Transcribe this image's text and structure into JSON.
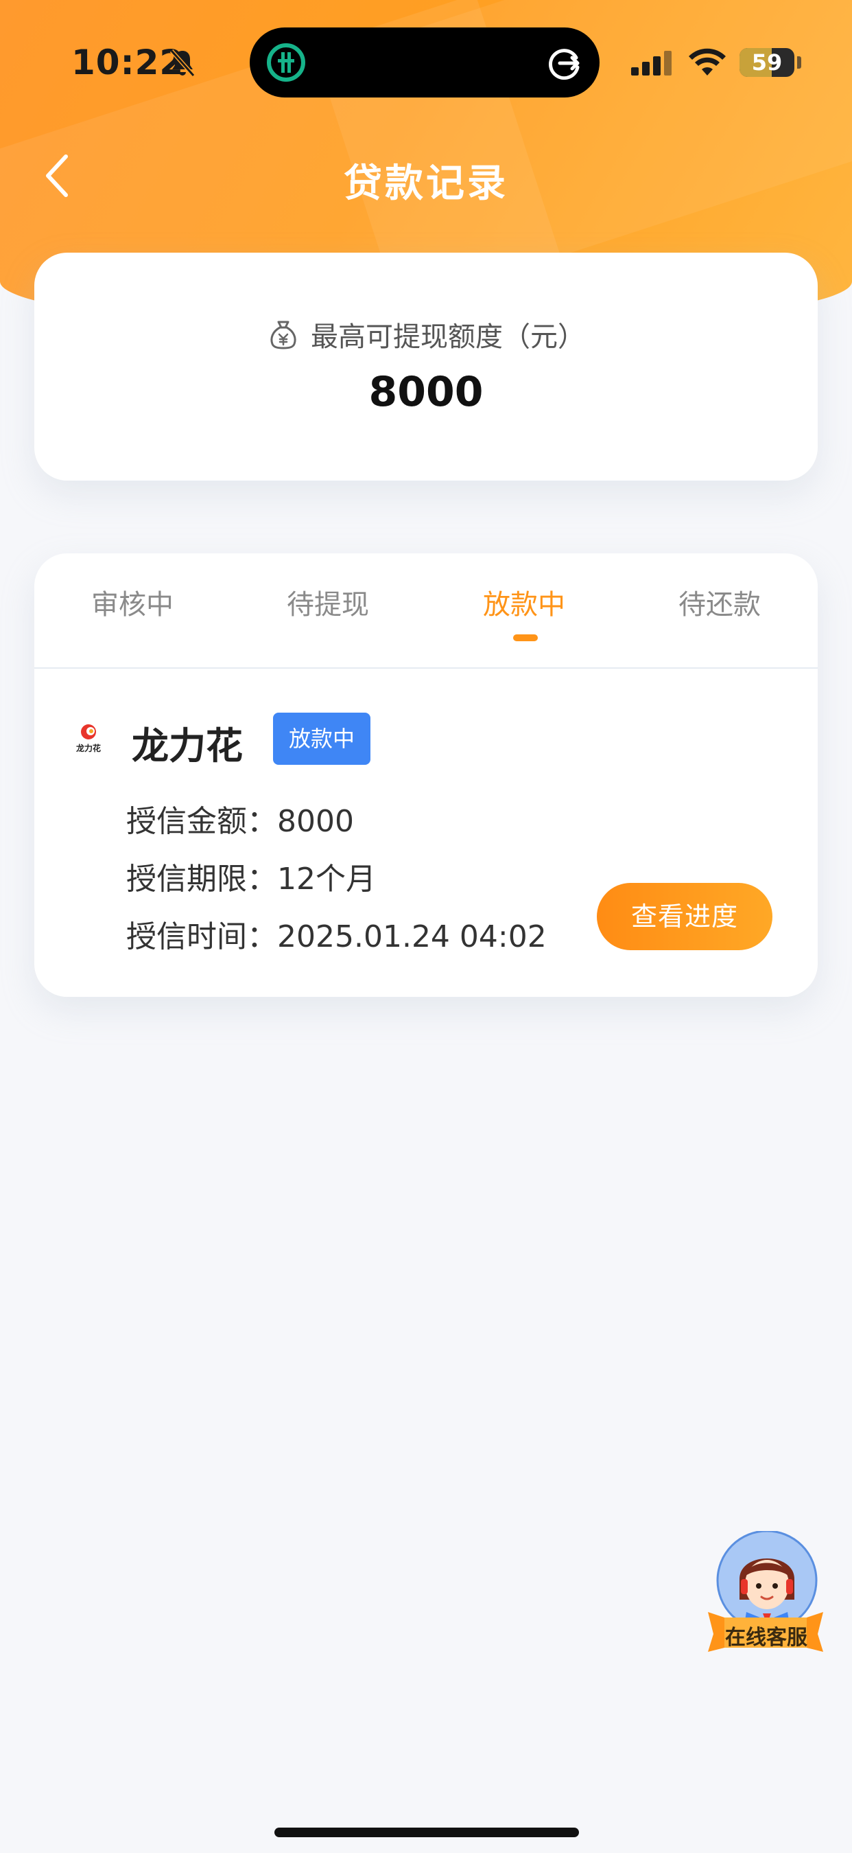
{
  "status_bar": {
    "time": "10:22",
    "battery": "59",
    "battery_level": 0.59,
    "icons": [
      "bell-slash-icon",
      "app-logo-icon",
      "rotate-icon",
      "signal-icon",
      "wifi-icon",
      "battery-icon"
    ]
  },
  "nav": {
    "title": "贷款记录",
    "back_icon": "chevron-left-icon"
  },
  "quota": {
    "icon": "money-bag-icon",
    "label": "最高可提现额度（元）",
    "value": "8000"
  },
  "tabs": [
    {
      "label": "审核中",
      "active": false
    },
    {
      "label": "待提现",
      "active": false
    },
    {
      "label": "放款中",
      "active": true
    },
    {
      "label": "待还款",
      "active": false
    }
  ],
  "loan_item": {
    "brand_logo_text": "龙力花",
    "brand_name": "龙力花",
    "status": "放款中",
    "fields": [
      {
        "key": "授信金额：",
        "value": "8000"
      },
      {
        "key": "授信期限：",
        "value": "12个月"
      },
      {
        "key": "授信时间：",
        "value": "2025.01.24 04:02"
      }
    ],
    "action_label": "查看进度"
  },
  "customer_service": {
    "label": "在线客服"
  },
  "colors": {
    "accent": "#ff9418",
    "badge_blue": "#3f86f5",
    "header_gradient_start": "#ff9a2e",
    "header_gradient_end": "#ffb640",
    "page_bg": "#f6f7fa"
  }
}
